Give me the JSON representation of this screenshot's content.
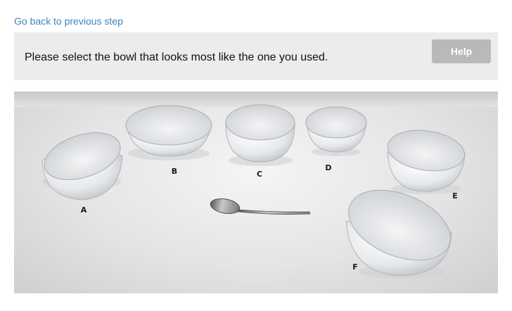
{
  "nav": {
    "back_label": "Go back to previous step"
  },
  "prompt": {
    "text": "Please select the bowl that looks most like the one you used."
  },
  "help": {
    "label": "Help"
  },
  "photo": {
    "bowls": [
      {
        "id": "A",
        "label": "A"
      },
      {
        "id": "B",
        "label": "B"
      },
      {
        "id": "C",
        "label": "C"
      },
      {
        "id": "D",
        "label": "D"
      },
      {
        "id": "E",
        "label": "E"
      },
      {
        "id": "F",
        "label": "F"
      }
    ]
  },
  "colors": {
    "link": "#3a86c0",
    "panel": "#ececec",
    "help_button": "#b9b9b9"
  }
}
